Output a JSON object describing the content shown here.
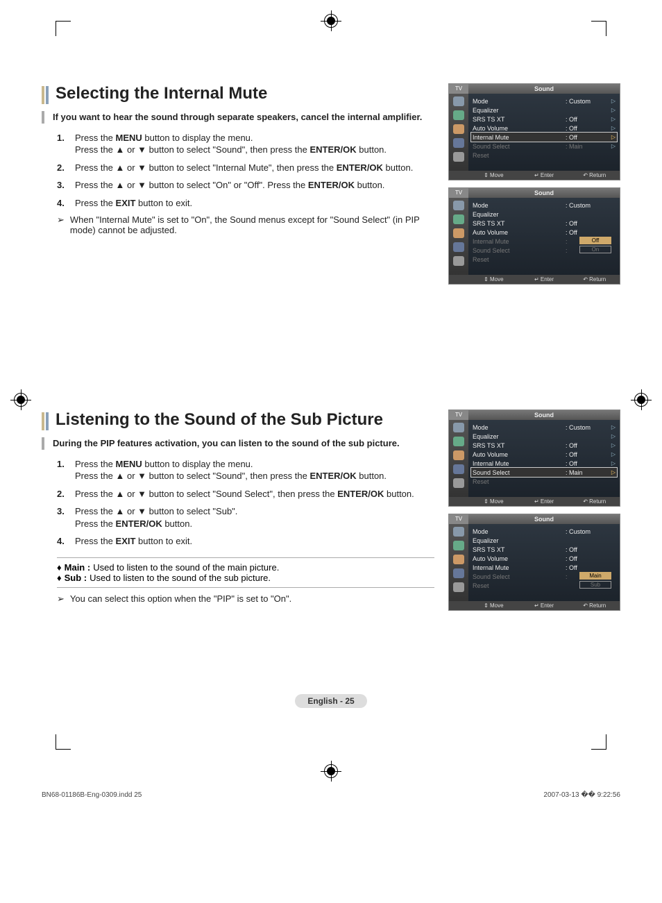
{
  "section1": {
    "heading": "Selecting the Internal Mute",
    "intro": "If you want to hear the sound through separate speakers, cancel the internal amplifier.",
    "steps": [
      {
        "num": "1.",
        "html": "Press the <b>MENU</b> button to display the menu.<br>Press the ▲ or ▼ button to select \"Sound\", then press the <b>ENTER/OK</b> button."
      },
      {
        "num": "2.",
        "html": "Press the ▲ or ▼ button to select \"Internal Mute\", then press the <b>ENTER/OK</b> button."
      },
      {
        "num": "3.",
        "html": "Press the ▲ or ▼ button to select \"On\" or \"Off\". Press the <b>ENTER/OK</b> button."
      },
      {
        "num": "4.",
        "html": "Press the <b>EXIT</b> button to exit."
      }
    ],
    "note_mark": "➢",
    "note": "When \"Internal Mute\" is set to \"On\", the Sound menus except for \"Sound Select\" (in PIP mode) cannot be adjusted."
  },
  "section2": {
    "heading": "Listening to the Sound of the Sub Picture",
    "intro": "During the PIP features activation, you can listen to the sound of the sub picture.",
    "steps": [
      {
        "num": "1.",
        "html": "Press the <b>MENU</b> button to display the menu.<br>Press the ▲ or ▼ button to select \"Sound\", then press the <b>ENTER/OK</b> button."
      },
      {
        "num": "2.",
        "html": "Press the ▲ or ▼ button to select \"Sound Select\", then press the <b>ENTER/OK</b> button."
      },
      {
        "num": "3.",
        "html": "Press the ▲ or ▼ button to select \"Sub\".<br>Press the <b>ENTER/OK</b> button."
      },
      {
        "num": "4.",
        "html": "Press the <b>EXIT</b> button to exit."
      }
    ],
    "bullets": [
      {
        "mark": "♦",
        "label": "Main :",
        "text": " Used to listen to the sound of the main picture."
      },
      {
        "mark": "♦",
        "label": "Sub :",
        "text": "  Used to listen to the sound of the sub picture."
      }
    ],
    "note_mark": "➢",
    "note": "You can select this option when the \"PIP\" is set to \"On\"."
  },
  "osd_common": {
    "tv": "TV",
    "title": "Sound",
    "move": "Move",
    "enter": "Enter",
    "return": "Return",
    "move_icon": "⇕",
    "enter_icon": "↵",
    "return_icon": "↶",
    "arrow": "▷"
  },
  "osd1": {
    "rows": [
      {
        "lbl": "Mode",
        "val": ": Custom",
        "arr": true
      },
      {
        "lbl": "Equalizer",
        "val": "",
        "arr": true
      },
      {
        "lbl": "SRS TS XT",
        "val": ": Off",
        "arr": true
      },
      {
        "lbl": "Auto Volume",
        "val": ": Off",
        "arr": true
      },
      {
        "lbl": "Internal Mute",
        "val": ": Off",
        "arr": true,
        "sel": true
      },
      {
        "lbl": "Sound Select",
        "val": ": Main",
        "arr": true,
        "dim": true
      },
      {
        "lbl": "Reset",
        "val": "",
        "arr": false,
        "dim": true
      }
    ]
  },
  "osd2": {
    "rows": [
      {
        "lbl": "Mode",
        "val": ": Custom"
      },
      {
        "lbl": "Equalizer",
        "val": ""
      },
      {
        "lbl": "SRS TS XT",
        "val": ": Off"
      },
      {
        "lbl": "Auto Volume",
        "val": ": Off"
      },
      {
        "lbl": "Internal Mute",
        "val": ":",
        "dim": true,
        "opts": [
          {
            "t": "Off",
            "sel": true
          },
          {
            "t": "On"
          }
        ]
      },
      {
        "lbl": "Sound Select",
        "val": ":",
        "dim": true
      },
      {
        "lbl": "Reset",
        "val": "",
        "dim": true
      }
    ]
  },
  "osd3": {
    "rows": [
      {
        "lbl": "Mode",
        "val": ": Custom",
        "arr": true
      },
      {
        "lbl": "Equalizer",
        "val": "",
        "arr": true
      },
      {
        "lbl": "SRS TS XT",
        "val": ": Off",
        "arr": true
      },
      {
        "lbl": "Auto Volume",
        "val": ": Off",
        "arr": true
      },
      {
        "lbl": "Internal Mute",
        "val": ": Off",
        "arr": true
      },
      {
        "lbl": "Sound Select",
        "val": ": Main",
        "arr": true,
        "sel": true
      },
      {
        "lbl": "Reset",
        "val": "",
        "dim": true
      }
    ]
  },
  "osd4": {
    "rows": [
      {
        "lbl": "Mode",
        "val": ": Custom"
      },
      {
        "lbl": "Equalizer",
        "val": ""
      },
      {
        "lbl": "SRS TS XT",
        "val": ": Off"
      },
      {
        "lbl": "Auto Volume",
        "val": ": Off"
      },
      {
        "lbl": "Internal Mute",
        "val": ": Off"
      },
      {
        "lbl": "Sound Select",
        "val": ":",
        "dim": true,
        "opts": [
          {
            "t": "Main",
            "sel": true
          },
          {
            "t": "Sub"
          }
        ]
      },
      {
        "lbl": "Reset",
        "val": "",
        "dim": true
      }
    ]
  },
  "page_label": "English - 25",
  "footer": {
    "left": "BN68-01186B-Eng-0309.indd   25",
    "right": "2007-03-13   �� 9:22:56"
  }
}
